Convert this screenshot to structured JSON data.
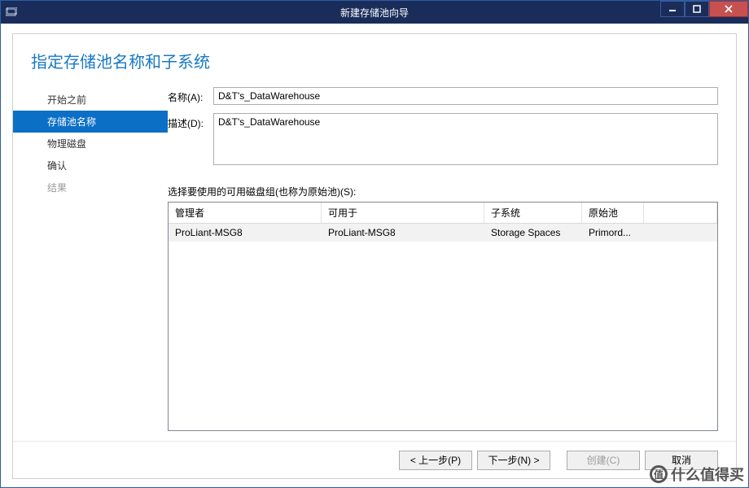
{
  "window": {
    "title": "新建存储池向导"
  },
  "heading": "指定存储池名称和子系统",
  "steps": [
    {
      "label": "开始之前"
    },
    {
      "label": "存储池名称"
    },
    {
      "label": "物理磁盘"
    },
    {
      "label": "确认"
    },
    {
      "label": "结果"
    }
  ],
  "form": {
    "name_label": "名称(A):",
    "name_value": "D&T's_DataWarehouse",
    "desc_label": "描述(D):",
    "desc_value": "D&T's_DataWarehouse",
    "group_label": "选择要使用的可用磁盘组(也称为原始池)(S):"
  },
  "table": {
    "headers": {
      "manager": "管理者",
      "available": "可用于",
      "subsystem": "子系统",
      "primordial": "原始池"
    },
    "rows": [
      {
        "manager": "ProLiant-MSG8",
        "available": "ProLiant-MSG8",
        "subsystem": "Storage Spaces",
        "primordial": "Primord..."
      }
    ]
  },
  "buttons": {
    "prev": "< 上一步(P)",
    "next": "下一步(N) >",
    "create": "创建(C)",
    "cancel": "取消"
  },
  "watermark": {
    "badge": "值",
    "text": "什么值得买"
  }
}
